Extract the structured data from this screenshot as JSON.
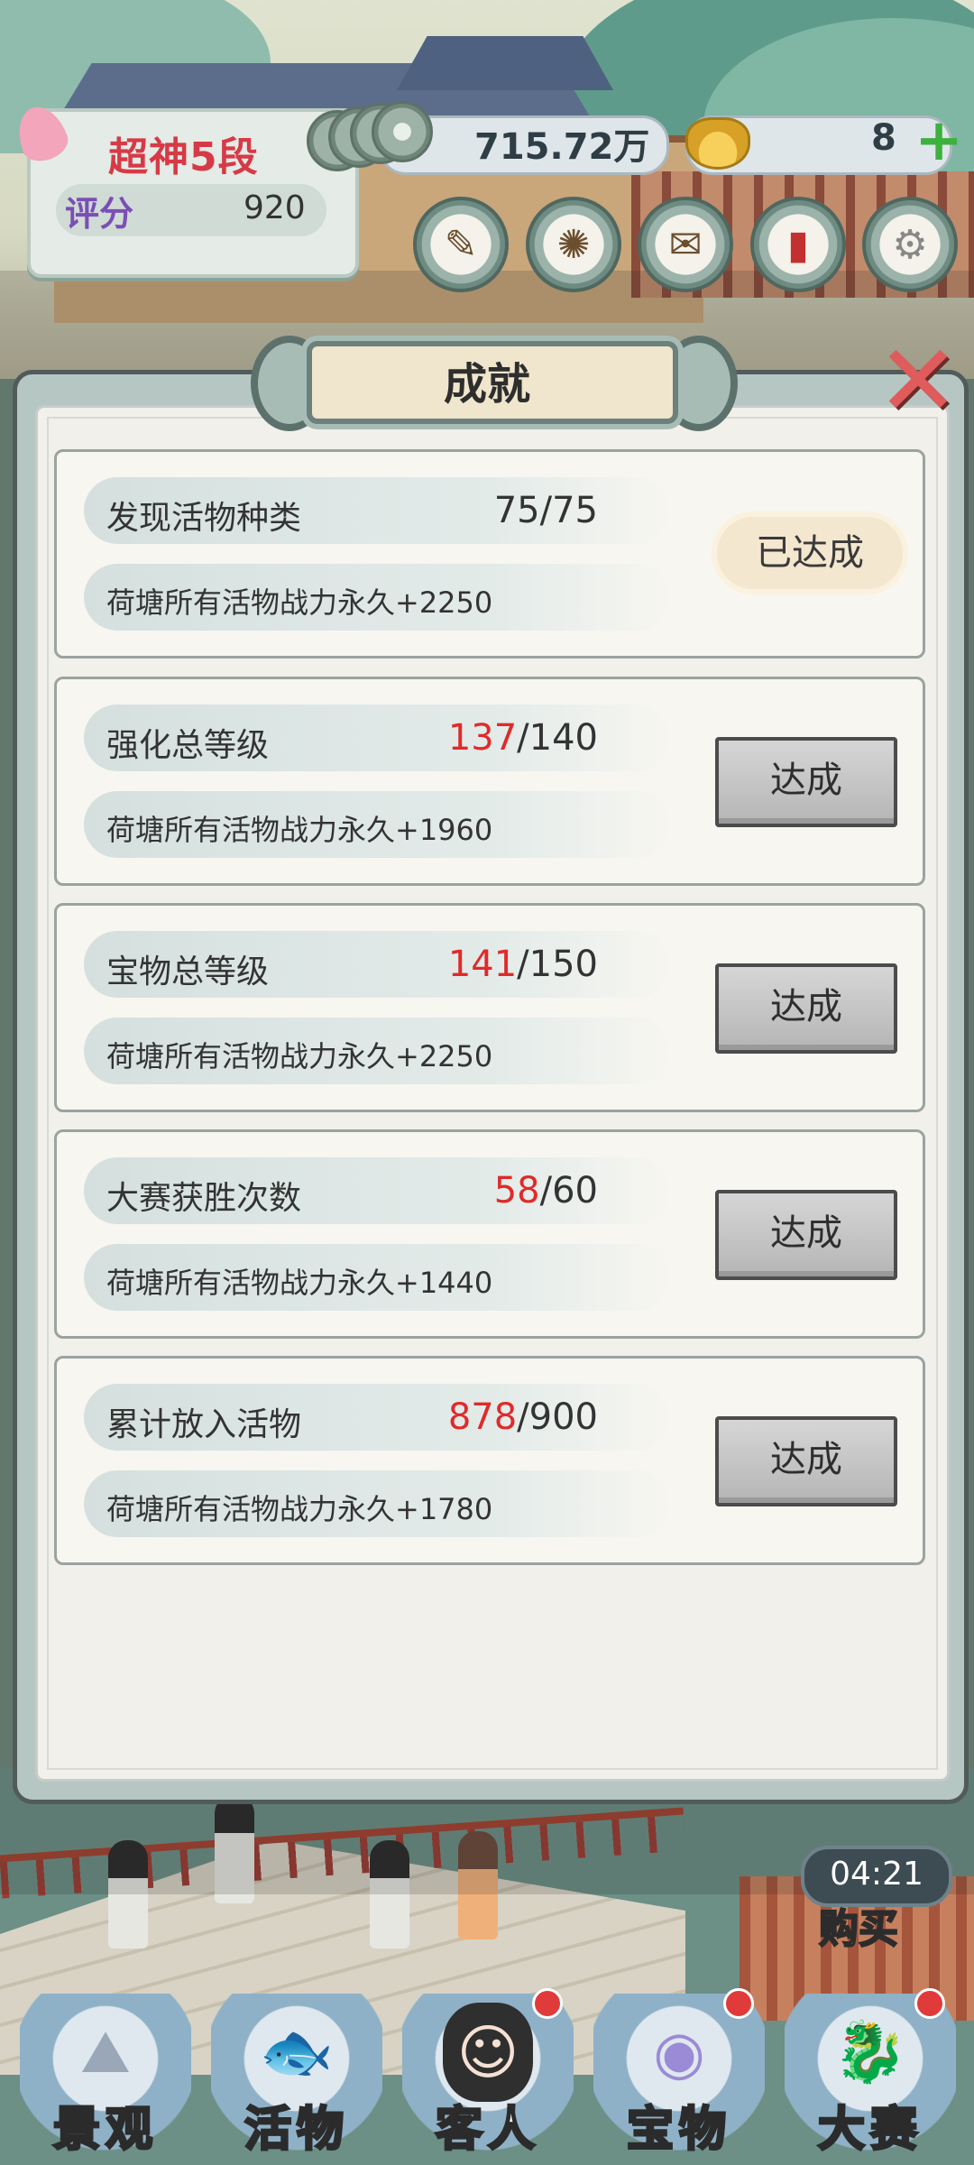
{
  "hud": {
    "rank": "超神5段",
    "score_label": "评分",
    "score_value": "920",
    "coins": "715.72万",
    "gold": "8",
    "tool_icons": [
      "brush-scroll-icon",
      "compass-icon",
      "letter-icon",
      "red-book-icon",
      "gear-icon"
    ]
  },
  "panel": {
    "title": "成就",
    "achievements": [
      {
        "label": "发现活物种类",
        "current": "75",
        "total": "/75",
        "current_highlight": false,
        "reward": "荷塘所有活物战力永久+2250",
        "button": "已达成",
        "done": true
      },
      {
        "label": "强化总等级",
        "current": "137",
        "total": "/140",
        "current_highlight": true,
        "reward": "荷塘所有活物战力永久+1960",
        "button": "达成",
        "done": false
      },
      {
        "label": "宝物总等级",
        "current": "141",
        "total": "/150",
        "current_highlight": true,
        "reward": "荷塘所有活物战力永久+2250",
        "button": "达成",
        "done": false
      },
      {
        "label": "大赛获胜次数",
        "current": "58",
        "total": "/60",
        "current_highlight": true,
        "reward": "荷塘所有活物战力永久+1440",
        "button": "达成",
        "done": false
      },
      {
        "label": "累计放入活物",
        "current": "878",
        "total": "/900",
        "current_highlight": true,
        "reward": "荷塘所有活物战力永久+1780",
        "button": "达成",
        "done": false
      }
    ]
  },
  "shop": {
    "timer": "04:21",
    "buy": "购买"
  },
  "nav": [
    {
      "label": "景观",
      "icon": "rock-icon"
    },
    {
      "label": "活物",
      "icon": "fish-icon"
    },
    {
      "label": "客人",
      "icon": "girl-avatar-icon"
    },
    {
      "label": "宝物",
      "icon": "pearl-shell-icon"
    },
    {
      "label": "大赛",
      "icon": "dragon-fish-icon"
    }
  ],
  "colors": {
    "highlight_red": "#e02a2a",
    "rank_red": "#d63a46",
    "score_purple": "#7a4fb5",
    "plus_green": "#3db13d"
  }
}
